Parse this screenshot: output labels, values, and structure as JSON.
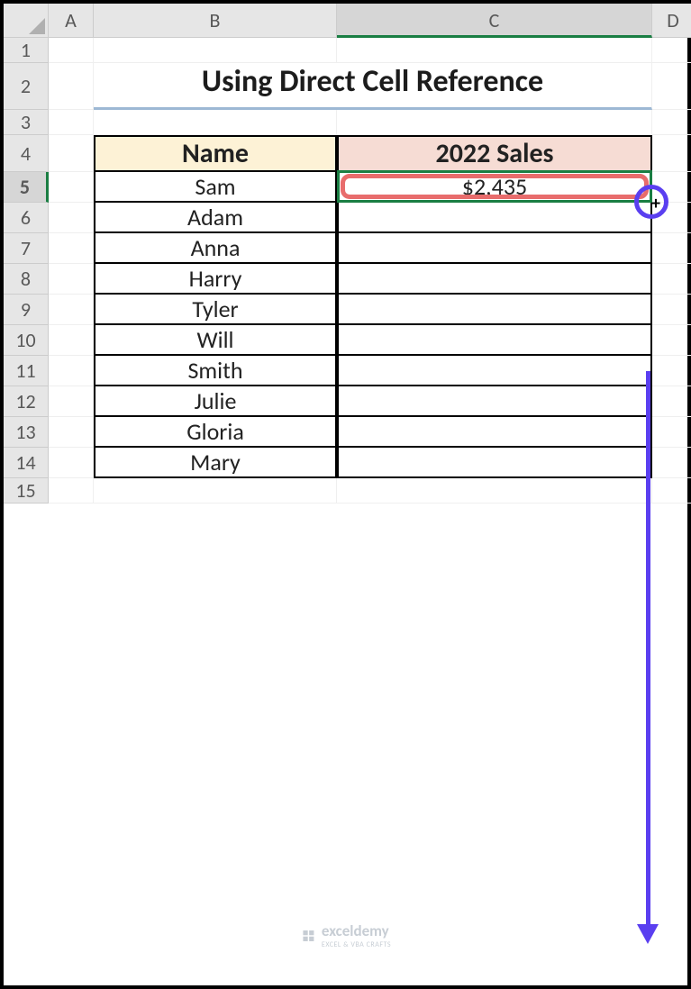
{
  "columns": {
    "A": "A",
    "B": "B",
    "C": "C",
    "D": "D"
  },
  "rows": {
    "1": "1",
    "2": "2",
    "3": "3",
    "4": "4",
    "5": "5",
    "6": "6",
    "7": "7",
    "8": "8",
    "9": "9",
    "10": "10",
    "11": "11",
    "12": "12",
    "13": "13",
    "14": "14",
    "15": "15"
  },
  "title": "Using Direct Cell Reference",
  "headers": {
    "name": "Name",
    "sales": "2022 Sales"
  },
  "names": [
    "Sam",
    "Adam",
    "Anna",
    "Harry",
    "Tyler",
    "Will",
    "Smith",
    "Julie",
    "Gloria",
    "Mary"
  ],
  "sales_values": [
    "$2,435"
  ],
  "selected_cell": "C5",
  "watermark": {
    "brand": "exceldemy",
    "tag": "EXCEL & VBA CRAFTS"
  }
}
